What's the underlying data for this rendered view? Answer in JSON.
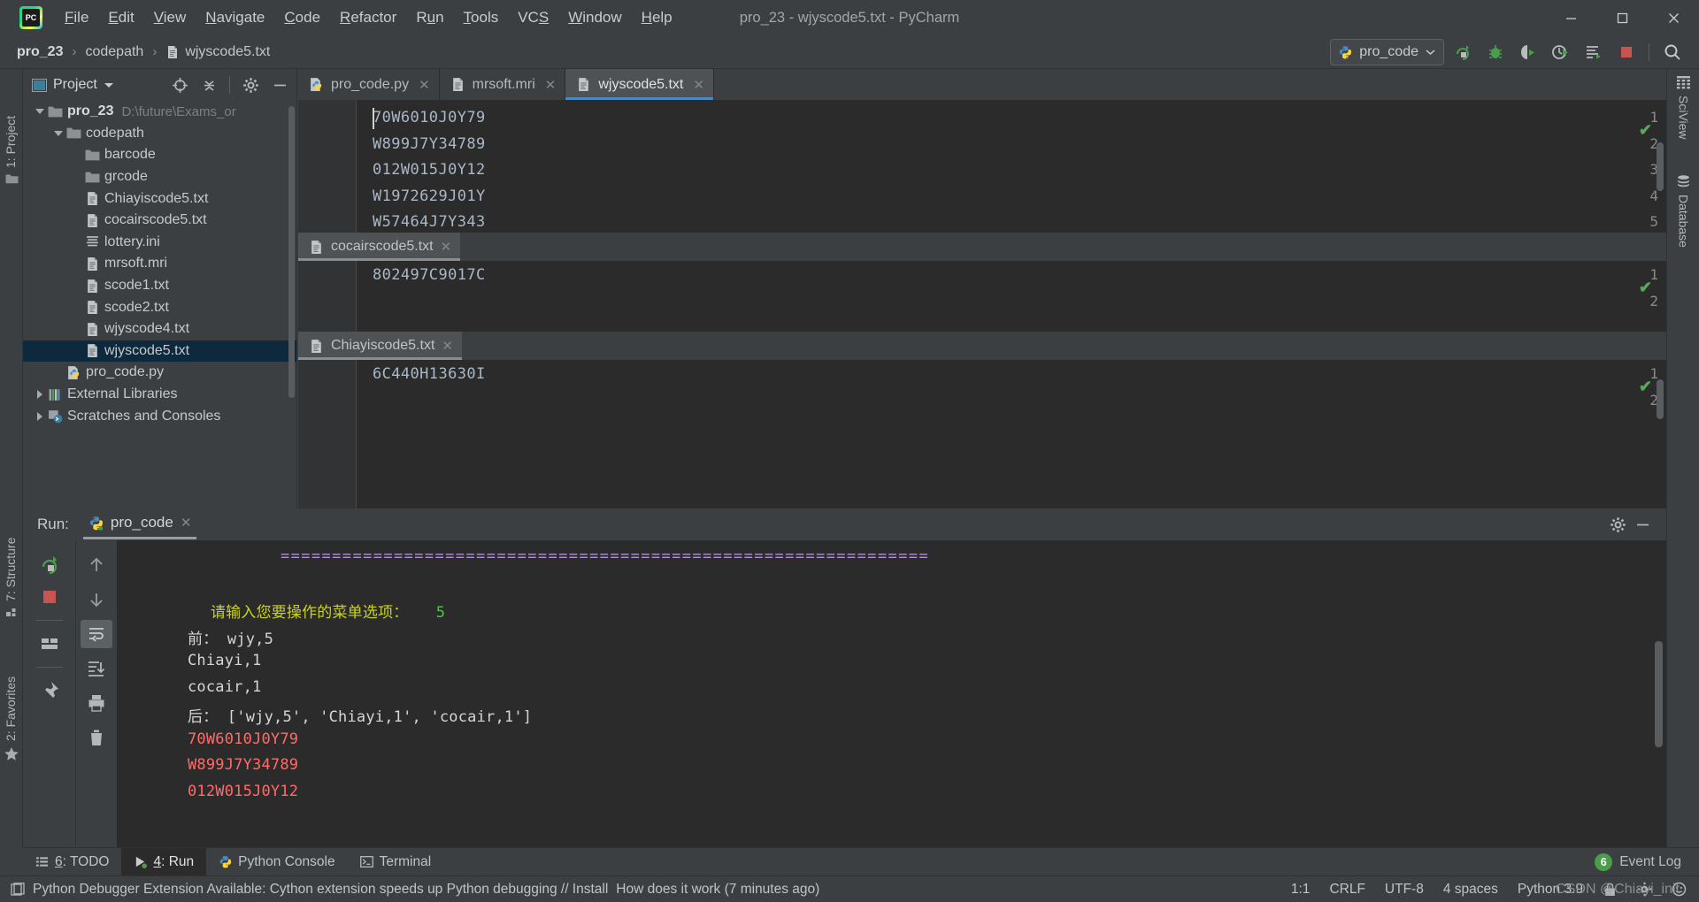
{
  "window": {
    "title": "pro_23 - wjyscode5.txt - PyCharm",
    "app_logo": "pycharm-logo",
    "minimize": "—",
    "maximize": "❐",
    "close": "✕"
  },
  "menu": [
    {
      "label": "File",
      "mnemonic": "F"
    },
    {
      "label": "Edit",
      "mnemonic": "E"
    },
    {
      "label": "View",
      "mnemonic": "V"
    },
    {
      "label": "Navigate",
      "mnemonic": "N"
    },
    {
      "label": "Code",
      "mnemonic": "C"
    },
    {
      "label": "Refactor",
      "mnemonic": "R"
    },
    {
      "label": "Run",
      "mnemonic": "u"
    },
    {
      "label": "Tools",
      "mnemonic": "T"
    },
    {
      "label": "VCS",
      "mnemonic": "S"
    },
    {
      "label": "Window",
      "mnemonic": "W"
    },
    {
      "label": "Help",
      "mnemonic": "H"
    }
  ],
  "breadcrumb": [
    {
      "label": "pro_23",
      "bold": true
    },
    {
      "label": "codepath",
      "bold": false
    },
    {
      "label": "wjyscode5.txt",
      "bold": false,
      "icon": "file-txt-icon"
    }
  ],
  "toolbar": {
    "run_config": "pro_code",
    "buttons": [
      {
        "name": "run-button",
        "glyph": "run"
      },
      {
        "name": "debug-button",
        "glyph": "debug"
      },
      {
        "name": "run-coverage-button",
        "glyph": "coverage"
      },
      {
        "name": "profile-button",
        "glyph": "profile"
      },
      {
        "name": "run-with-button",
        "glyph": "runwith"
      },
      {
        "name": "stop-button",
        "glyph": "stop"
      },
      {
        "name": "search-everywhere-button",
        "glyph": "search"
      }
    ]
  },
  "left_rail": [
    {
      "label": "1: Project",
      "icon": "project-icon"
    },
    {
      "label": "7: Structure",
      "icon": "structure-icon"
    },
    {
      "label": "2: Favorites",
      "icon": "star-icon"
    }
  ],
  "right_rail": [
    {
      "label": "SciView",
      "icon": "grid-icon"
    },
    {
      "label": "Database",
      "icon": "database-icon"
    }
  ],
  "project_panel": {
    "title": "Project",
    "tools": [
      "target-icon",
      "collapse-all-icon",
      "gear-icon",
      "hide-icon"
    ],
    "tree": [
      {
        "label": "pro_23",
        "path": "D:\\future\\Exams_or",
        "indent": 0,
        "twisty": "down",
        "icon": "folder-icon",
        "bold": true,
        "selected": false
      },
      {
        "label": "codepath",
        "path": "",
        "indent": 1,
        "twisty": "down",
        "icon": "folder-icon",
        "bold": false,
        "selected": false
      },
      {
        "label": "barcode",
        "path": "",
        "indent": 2,
        "twisty": "none",
        "icon": "folder-icon",
        "bold": false,
        "selected": false
      },
      {
        "label": "grcode",
        "path": "",
        "indent": 2,
        "twisty": "none",
        "icon": "folder-icon",
        "bold": false,
        "selected": false
      },
      {
        "label": "Chiayiscode5.txt",
        "path": "",
        "indent": 2,
        "twisty": "none",
        "icon": "file-txt-icon",
        "bold": false,
        "selected": false
      },
      {
        "label": "cocairscode5.txt",
        "path": "",
        "indent": 2,
        "twisty": "none",
        "icon": "file-txt-icon",
        "bold": false,
        "selected": false
      },
      {
        "label": "lottery.ini",
        "path": "",
        "indent": 2,
        "twisty": "none",
        "icon": "file-ini-icon",
        "bold": false,
        "selected": false
      },
      {
        "label": "mrsoft.mri",
        "path": "",
        "indent": 2,
        "twisty": "none",
        "icon": "file-txt-icon",
        "bold": false,
        "selected": false
      },
      {
        "label": "scode1.txt",
        "path": "",
        "indent": 2,
        "twisty": "none",
        "icon": "file-txt-icon",
        "bold": false,
        "selected": false
      },
      {
        "label": "scode2.txt",
        "path": "",
        "indent": 2,
        "twisty": "none",
        "icon": "file-txt-icon",
        "bold": false,
        "selected": false
      },
      {
        "label": "wjyscode4.txt",
        "path": "",
        "indent": 2,
        "twisty": "none",
        "icon": "file-txt-icon",
        "bold": false,
        "selected": false
      },
      {
        "label": "wjyscode5.txt",
        "path": "",
        "indent": 2,
        "twisty": "none",
        "icon": "file-txt-icon",
        "bold": false,
        "selected": true
      },
      {
        "label": "pro_code.py",
        "path": "",
        "indent": 1,
        "twisty": "none",
        "icon": "python-file-icon",
        "bold": false,
        "selected": false
      },
      {
        "label": "External Libraries",
        "path": "",
        "indent": 0,
        "twisty": "right",
        "icon": "libraries-icon",
        "bold": false,
        "selected": false
      },
      {
        "label": "Scratches and Consoles",
        "path": "",
        "indent": 0,
        "twisty": "right",
        "icon": "scratches-icon",
        "bold": false,
        "selected": false
      }
    ]
  },
  "editor": {
    "tabs": [
      {
        "label": "pro_code.py",
        "icon": "python-file-icon",
        "active": false
      },
      {
        "label": "mrsoft.mri",
        "icon": "file-txt-icon",
        "active": false
      },
      {
        "label": "wjyscode5.txt",
        "icon": "file-txt-icon",
        "active": true
      }
    ],
    "panes": [
      {
        "name": "wjyscode5",
        "has_tab": false,
        "tab_label": "",
        "lines": [
          {
            "n": "1",
            "text": "70W6010J0Y79"
          },
          {
            "n": "2",
            "text": "W899J7Y34789"
          },
          {
            "n": "3",
            "text": "012W015J0Y12"
          },
          {
            "n": "4",
            "text": "W1972629J01Y"
          },
          {
            "n": "5",
            "text": "W57464J7Y343"
          }
        ]
      },
      {
        "name": "cocairscode5",
        "has_tab": true,
        "tab_label": "cocairscode5.txt",
        "lines": [
          {
            "n": "1",
            "text": "802497C9017C"
          },
          {
            "n": "2",
            "text": ""
          }
        ]
      },
      {
        "name": "Chiayiscode5",
        "has_tab": true,
        "tab_label": "Chiayiscode5.txt",
        "lines": [
          {
            "n": "1",
            "text": "6C440H13630I"
          },
          {
            "n": "2",
            "text": ""
          }
        ]
      }
    ],
    "inspection_ok": "✔"
  },
  "run_panel": {
    "label": "Run:",
    "tab": "pro_code",
    "header_buttons": [
      "gear-icon",
      "hide-icon"
    ],
    "side_buttons": [
      {
        "name": "rerun-button",
        "glyph": "rerun"
      },
      {
        "name": "stop-button",
        "glyph": "stop"
      },
      {
        "name": "layout-button",
        "glyph": "layout"
      },
      {
        "name": "pin-button",
        "glyph": "pin"
      }
    ],
    "side_buttons2": [
      {
        "name": "up-button",
        "glyph": "up"
      },
      {
        "name": "down-button",
        "glyph": "down"
      },
      {
        "name": "soft-wrap-button",
        "glyph": "wrap"
      },
      {
        "name": "scroll-end-button",
        "glyph": "scrollend"
      },
      {
        "name": "print-button",
        "glyph": "print"
      },
      {
        "name": "clear-all-button",
        "glyph": "trash"
      }
    ],
    "console_lines": [
      {
        "cls": "c-sep",
        "text": "==============================================================="
      },
      {
        "cls": "blank",
        "text": ""
      },
      {
        "cls": "prompt",
        "text": "  请输入您要操作的菜单选项：",
        "value": "5"
      },
      {
        "cls": "c-white",
        "text": "前： wjy,5"
      },
      {
        "cls": "c-white",
        "text": "Chiayi,1"
      },
      {
        "cls": "c-white",
        "text": "cocair,1"
      },
      {
        "cls": "c-white",
        "text": "后： ['wjy,5', 'Chiayi,1', 'cocair,1']"
      },
      {
        "cls": "c-red",
        "text": "70W6010J0Y79"
      },
      {
        "cls": "c-red",
        "text": "W899J7Y34789"
      },
      {
        "cls": "c-red",
        "text": "012W015J0Y12"
      }
    ]
  },
  "tool_tabs": [
    {
      "label": "6: TODO",
      "mnemonic": "6",
      "icon": "todo-icon",
      "active": false
    },
    {
      "label": "4: Run",
      "mnemonic": "4",
      "icon": "run-green-icon",
      "active": true
    },
    {
      "label": "Python Console",
      "mnemonic": "",
      "icon": "python-icon",
      "active": false
    },
    {
      "label": "Terminal",
      "mnemonic": "",
      "icon": "terminal-icon",
      "active": false
    }
  ],
  "event_log": {
    "count": "6",
    "label": "Event Log"
  },
  "statusbar": {
    "message": "Python Debugger Extension Available: Cython extension speeds up Python debugging // Install",
    "link": "How does it work (7 minutes ago)",
    "items": [
      "1:1",
      "CRLF",
      "UTF-8",
      "4 spaces",
      "Python 3.9"
    ],
    "icons": [
      "lock-icon",
      "cog-icon",
      "face-icon"
    ]
  },
  "watermark": "CSDN @Chiayi_init",
  "colors": {
    "bg": "#3c3f41",
    "editor_bg": "#2b2b2b",
    "accent": "#4a88c7",
    "selection": "#0d293e",
    "code_fg": "#a9b7c6",
    "console_red": "#ff6b68",
    "console_yellow": "#c8d420",
    "console_green": "#4fc24f",
    "console_purple": "#b08fd8",
    "ok_green": "#5aa85a"
  }
}
